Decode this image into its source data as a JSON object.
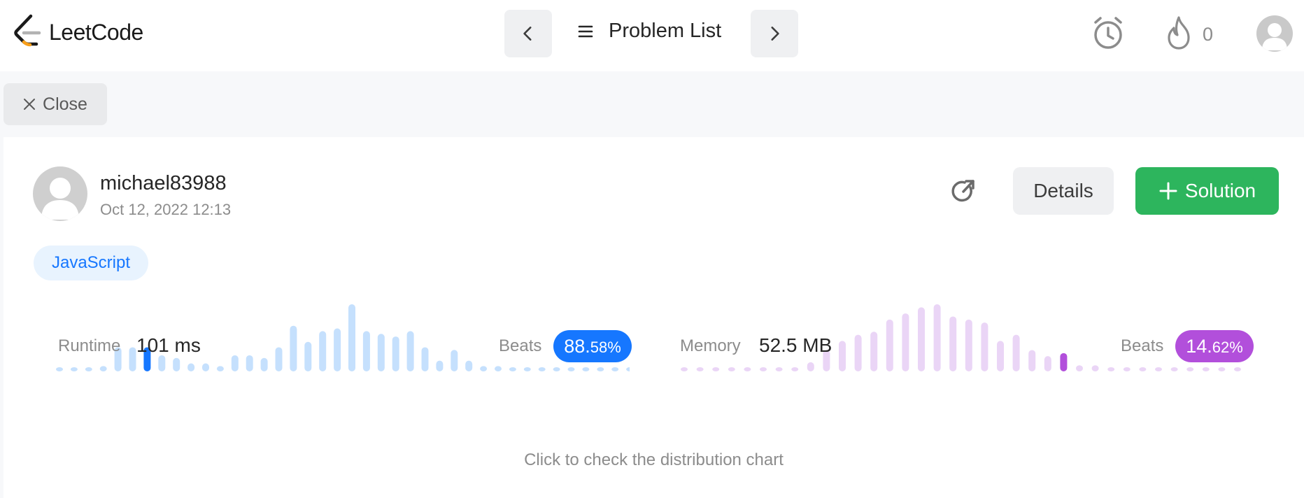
{
  "app": {
    "brand": "LeetCode"
  },
  "header": {
    "problem_list_label": "Problem List",
    "streak_count": "0"
  },
  "toolbar": {
    "close_label": "Close"
  },
  "submission": {
    "username": "michael83988",
    "date": "Oct 12, 2022 12:13",
    "details_label": "Details",
    "solution_label": "Solution",
    "language": "JavaScript"
  },
  "runtime": {
    "label": "Runtime",
    "value": "101 ms",
    "beats_label": "Beats",
    "beats_big": "88.",
    "beats_small": "58%",
    "color": "#1677ff",
    "bar_color": "#c5e0fd"
  },
  "memory": {
    "label": "Memory",
    "value": "52.5 MB",
    "beats_label": "Beats",
    "beats_big": "14.",
    "beats_small": "62%",
    "color": "#b24fdb",
    "bar_color": "#ead5f6"
  },
  "hint": "Click to check the distribution chart",
  "chart_data": [
    {
      "type": "bar",
      "name": "runtime-distribution",
      "values": [
        1,
        1,
        1,
        2,
        9,
        9,
        9,
        6,
        5,
        3,
        3,
        2,
        6,
        6,
        5,
        9,
        17,
        11,
        15,
        16,
        25,
        15,
        14,
        13,
        15,
        9,
        4,
        8,
        4,
        2,
        2,
        1,
        1,
        1,
        1,
        1,
        1,
        1,
        1,
        1
      ],
      "highlight_index": 6,
      "ylim": [
        0,
        25
      ]
    },
    {
      "type": "bar",
      "name": "memory-distribution",
      "values": [
        1,
        1,
        1,
        1,
        1,
        1,
        1,
        1,
        3,
        7,
        10,
        12,
        13,
        17,
        19,
        21,
        22,
        18,
        17,
        16,
        10,
        12,
        7,
        5,
        6,
        2,
        2,
        1,
        1,
        1,
        1,
        1,
        1,
        1,
        1,
        1
      ],
      "highlight_index": 24,
      "ylim": [
        0,
        22
      ]
    }
  ]
}
